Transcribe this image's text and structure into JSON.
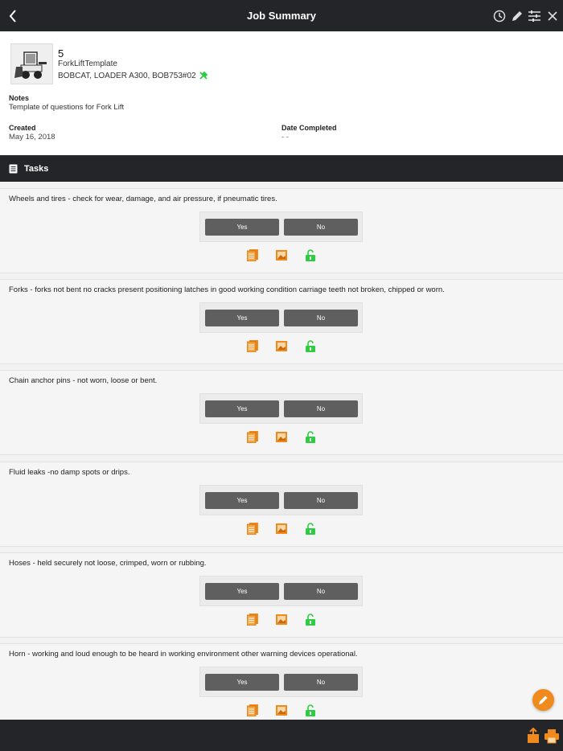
{
  "header": {
    "title": "Job Summary",
    "back_icon": "chevron-left-icon",
    "actions": [
      {
        "name": "history",
        "icon": "clock-icon"
      },
      {
        "name": "edit",
        "icon": "pencil-icon"
      },
      {
        "name": "filters",
        "icon": "sliders-icon"
      },
      {
        "name": "close",
        "icon": "close-icon"
      }
    ]
  },
  "job": {
    "number": "5",
    "template": "ForkLiftTemplate",
    "asset": "BOBCAT, LOADER A300, BOB753#02",
    "asset_icon": "tools-icon",
    "notes_label": "Notes",
    "notes": "Template of questions for Fork Lift",
    "created_label": "Created",
    "created": "May 16, 2018",
    "completed_label": "Date Completed",
    "completed": "- -"
  },
  "tasks_section": {
    "title": "Tasks",
    "icon": "list-icon"
  },
  "tasks": [
    {
      "question": "Wheels and tires - check for wear, damage, and air pressure, if pneumatic tires.",
      "yes": "Yes",
      "no": "No"
    },
    {
      "question": "Forks - forks not bent no cracks present positioning latches in good working condition carriage teeth not broken, chipped or worn.",
      "yes": "Yes",
      "no": "No"
    },
    {
      "question": "Chain anchor pins - not worn, loose or bent.",
      "yes": "Yes",
      "no": "No"
    },
    {
      "question": "Fluid leaks -no damp spots or drips.",
      "yes": "Yes",
      "no": "No"
    },
    {
      "question": "Hoses - held securely not loose, crimped, worn or rubbing.",
      "yes": "Yes",
      "no": "No"
    },
    {
      "question": "Horn - working and loud enough to be heard in working environment other warning devices operational.",
      "yes": "Yes",
      "no": "No"
    }
  ],
  "task_icons": [
    "notes-icon",
    "photo-icon",
    "unlock-icon"
  ],
  "colors": {
    "bar": "#242529",
    "accent": "#f08a1c",
    "button": "#5f5f5f",
    "unlock": "#2ecc40"
  },
  "fab_icon": "pencil-icon",
  "bottom_actions": [
    {
      "name": "share",
      "icon": "share-icon"
    },
    {
      "name": "print",
      "icon": "print-icon"
    }
  ]
}
